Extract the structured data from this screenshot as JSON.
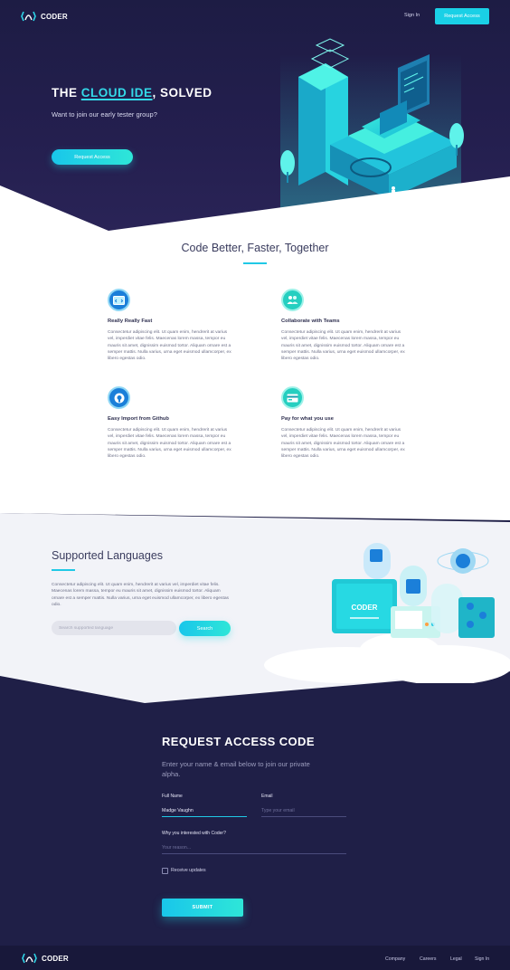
{
  "header": {
    "brand": "CODER",
    "nav_signin": "Sign In",
    "nav_request": "Request Access"
  },
  "hero": {
    "title_before": "THE ",
    "title_accent": "CLOUD IDE",
    "title_after": ", SOLVED",
    "subtitle": "Want to join our early tester group?",
    "button": "Request Access"
  },
  "features": {
    "title": "Code Better, Faster, Together",
    "items": [
      {
        "title": "Really Really Fast",
        "icon": "browser-code-icon",
        "body": "Consectetur adipiscing elit. Ut quam enim, hendrerit at varius vel, imperdiet vitae felis. Maecenas lorem massa, tempor eu mauris sit amet, dignissim euismod tortor. Aliquam ornare est a semper mattis. Nulla varius, urna eget euismod ullamcorper, ex libero egestas odio."
      },
      {
        "title": "Collaborate with Teams",
        "icon": "team-icon",
        "body": "Consectetur adipiscing elit. Ut quam enim, hendrerit at varius vel, imperdiet vitae felis. Maecenas lorem massa, tempor eu mauris sit amet, dignissim euismod tortor. Aliquam ornare est a semper mattis. Nulla varius, urna eget euismod ullamcorper, ex libero egestas odio."
      },
      {
        "title": "Easy Import from Github",
        "icon": "github-icon",
        "body": "Consectetur adipiscing elit. Ut quam enim, hendrerit at varius vel, imperdiet vitae felis. Maecenas lorem massa, tempor eu mauris sit amet, dignissim euismod tortor. Aliquam ornare est a semper mattis. Nulla varius, urna eget euismod ullamcorper, ex libero egestas odio."
      },
      {
        "title": "Pay for what you use",
        "icon": "payment-icon",
        "body": "Consectetur adipiscing elit. Ut quam enim, hendrerit at varius vel, imperdiet vitae felis. Maecenas lorem massa, tempor eu mauris sit amet, dignissim euismod tortor. Aliquam ornare est a semper mattis. Nulla varius, urna eget euismod ullamcorper, ex libero egestas odio."
      }
    ]
  },
  "languages": {
    "title": "Supported Languages",
    "body": "Consectetur adipiscing elit. Ut quam enim, hendrerit at varius vel, imperdiet vitae felis. Maecenas lorem massa, tempor eu mauris sit amet, dignissim euismod tortor. Aliquam ornare est a semper mattis. Nulla varius, urna eget euismod ullamcorper, ex libero egestas odio.",
    "search_placeholder": "Search supported language",
    "search_button": "Search",
    "art_label": "CODER"
  },
  "form": {
    "title": "REQUEST ACCESS CODE",
    "subtitle": "Enter your name & email below to join our private alpha.",
    "name_label": "Full Name",
    "name_value": "Madge Vaughn",
    "email_label": "Email",
    "email_placeholder": "Type your email",
    "reason_label": "Why you interested with Coder?",
    "reason_placeholder": "Your reason...",
    "checkbox_label": "Receive updates",
    "submit": "SUBMIT"
  },
  "footer": {
    "brand": "CODER",
    "links": [
      "Company",
      "Careers",
      "Legal",
      "Sign In"
    ]
  },
  "colors": {
    "accent": "#20c9e6",
    "dark_bg": "#1f1f47",
    "heading": "#3a3c5e"
  }
}
